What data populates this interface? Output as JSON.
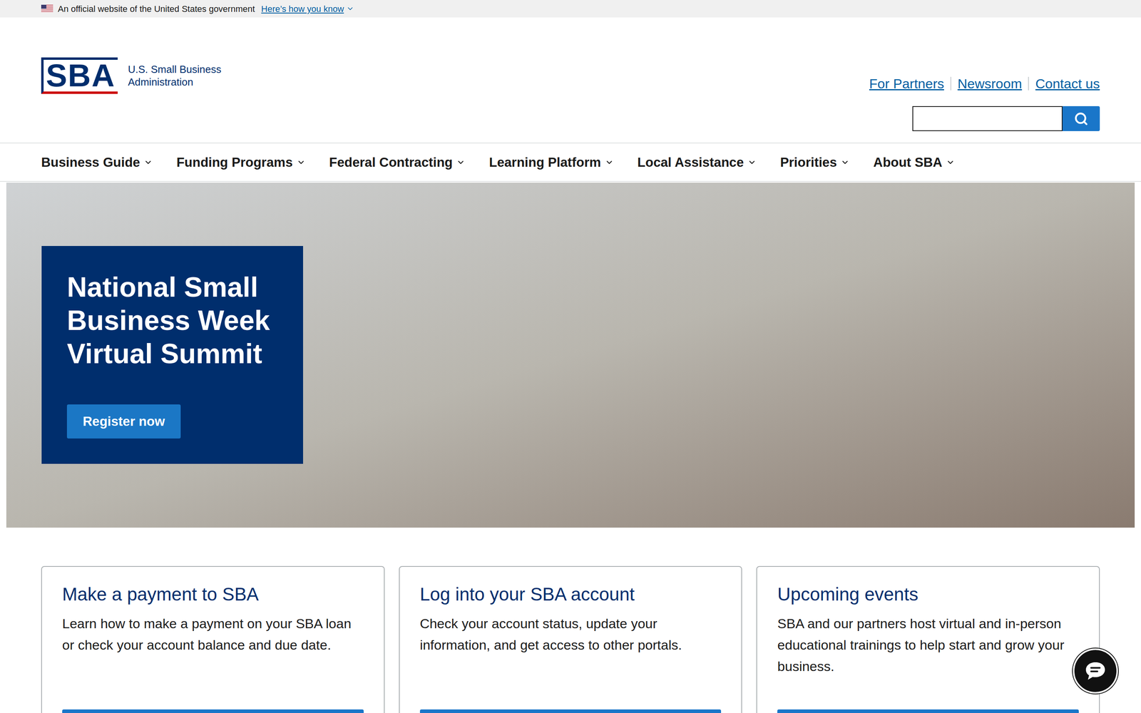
{
  "banner": {
    "text": "An official website of the United States government",
    "link": "Here’s how you know"
  },
  "logo": {
    "mark": "SBA",
    "name_line1": "U.S. Small Business",
    "name_line2": "Administration"
  },
  "utility_links": [
    "For Partners",
    "Newsroom",
    "Contact us"
  ],
  "nav": [
    {
      "label": "Business Guide"
    },
    {
      "label": "Funding Programs"
    },
    {
      "label": "Federal Contracting"
    },
    {
      "label": "Learning Platform"
    },
    {
      "label": "Local Assistance"
    },
    {
      "label": "Priorities"
    },
    {
      "label": "About SBA"
    }
  ],
  "hero": {
    "title": "National Small Business Week Virtual Summit",
    "button": "Register now"
  },
  "cards": [
    {
      "title": "Make a payment to SBA",
      "body": "Learn how to make a payment on your SBA loan or check your account balance and due date."
    },
    {
      "title": "Log into your SBA account",
      "body": "Check your account status, update your information, and get access to other portals."
    },
    {
      "title": "Upcoming events",
      "body": "SBA and our partners host virtual and in-person educational trainings to help start and grow your business."
    }
  ]
}
